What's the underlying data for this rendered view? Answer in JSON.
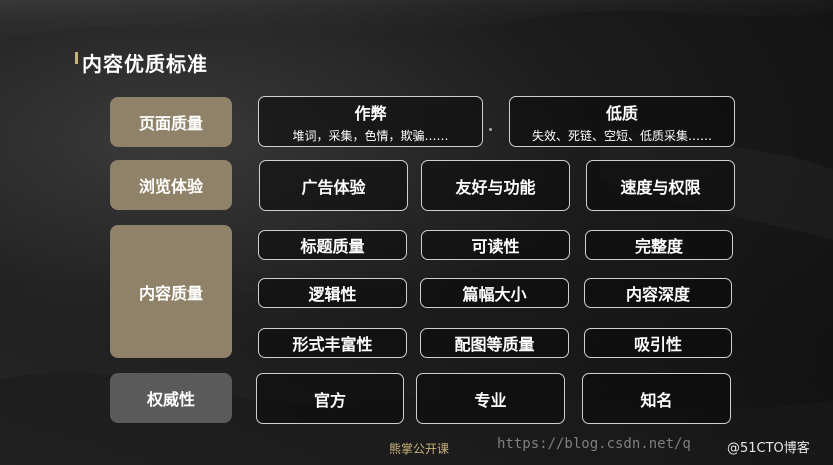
{
  "title": "内容优质标准",
  "categories": {
    "page_quality": "页面质量",
    "browse_experience": "浏览体验",
    "content_quality": "内容质量",
    "authority": "权威性"
  },
  "page_quality": {
    "cheating": {
      "label": "作弊",
      "detail": "堆词，采集，色情，欺骗……"
    },
    "low_quality": {
      "label": "低质",
      "detail": "失效、死链、空短、低质采集……"
    }
  },
  "browse_experience": {
    "items": [
      "广告体验",
      "友好与功能",
      "速度与权限"
    ]
  },
  "content_quality": {
    "row1": [
      "标题质量",
      "可读性",
      "完整度"
    ],
    "row2": [
      "逻辑性",
      "篇幅大小",
      "内容深度"
    ],
    "row3": [
      "形式丰富性",
      "配图等质量",
      "吸引性"
    ]
  },
  "authority": {
    "items": [
      "官方",
      "专业",
      "知名"
    ]
  },
  "footer": {
    "logo": "熊掌公开课",
    "watermark": "https://blog.csdn.net/q",
    "credit": "@51CTO博客"
  }
}
